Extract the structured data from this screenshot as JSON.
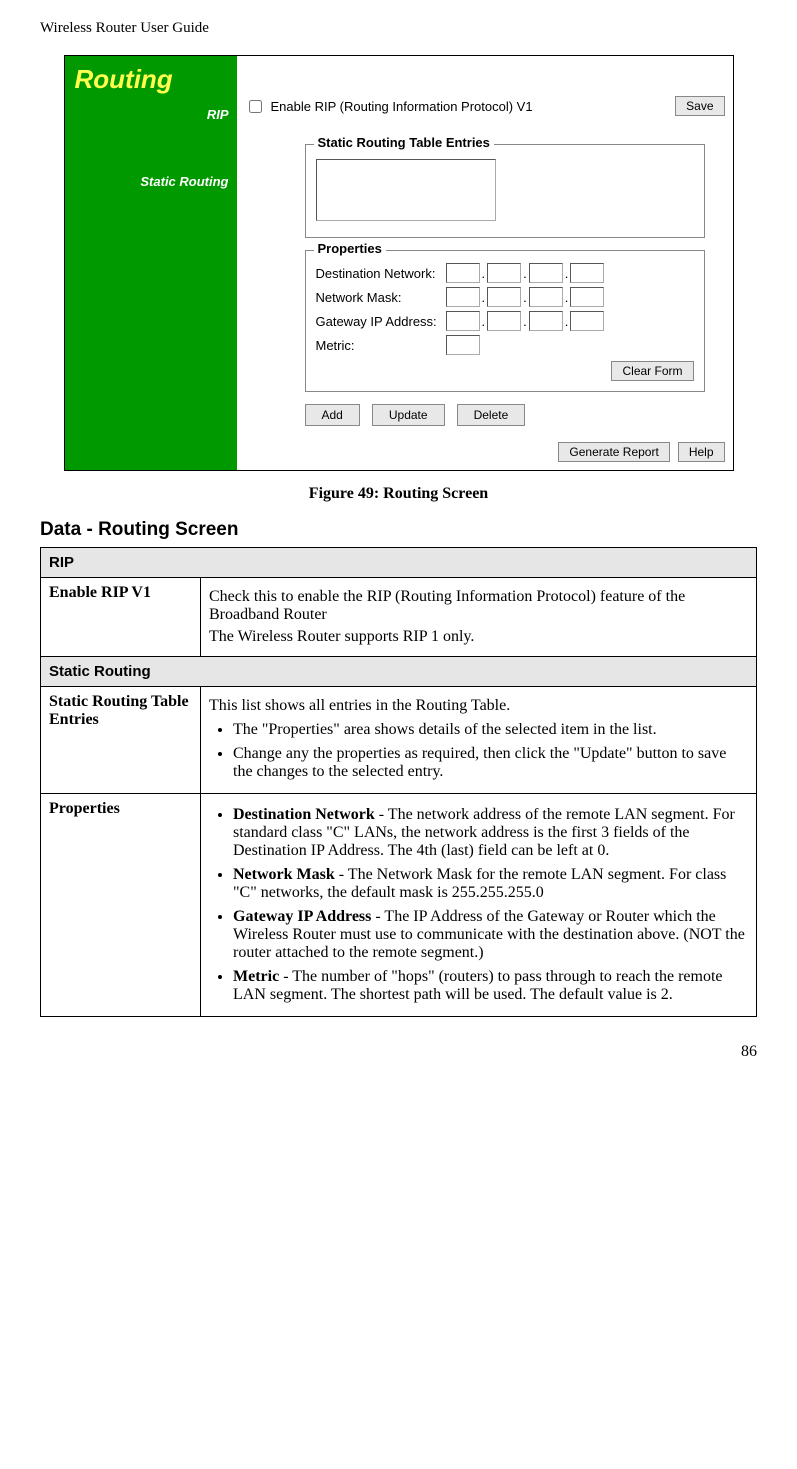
{
  "header": {
    "title": "Wireless Router User Guide"
  },
  "screenshot": {
    "panel_title": "Routing",
    "sidebar": {
      "rip": "RIP",
      "static": "Static Routing"
    },
    "rip": {
      "checkbox_label": "Enable RIP (Routing Information Protocol) V1",
      "save_btn": "Save"
    },
    "entries_fieldset": {
      "title": "Static Routing Table Entries"
    },
    "properties_fieldset": {
      "title": "Properties",
      "dest_net": "Destination Network:",
      "net_mask": "Network Mask:",
      "gw_ip": "Gateway IP Address:",
      "metric": "Metric:",
      "clear_btn": "Clear Form"
    },
    "btns": {
      "add": "Add",
      "update": "Update",
      "delete": "Delete"
    },
    "footer_btns": {
      "gen_report": "Generate Report",
      "help": "Help"
    }
  },
  "figure_caption": "Figure 49: Routing Screen",
  "section_heading": "Data - Routing Screen",
  "table": {
    "s1": "RIP",
    "r1_label": "Enable RIP V1",
    "r1_p1": "Check this to enable the RIP (Routing Information Protocol) feature of the Broadband Router",
    "r1_p2": "The Wireless Router supports RIP 1 only.",
    "s2": "Static Routing",
    "r2_label": "Static Routing Table Entries",
    "r2_p1": "This list shows all entries in the Routing Table.",
    "r2_b1": "The \"Properties\" area shows details of the selected item in the list.",
    "r2_b2": "Change any the properties as required, then click the \"Update\" button to save the changes to the selected entry.",
    "r3_label": "Properties",
    "r3_b1_strong": "Destination Network",
    "r3_b1_rest": " - The network address of the remote LAN segment. For standard class \"C\" LANs, the network address is the first 3 fields of the Destination IP Address. The 4th (last) field can be left at 0.",
    "r3_b2_strong": "Network Mask",
    "r3_b2_rest": " - The Network Mask for the remote LAN segment. For class \"C\" networks, the default mask is 255.255.255.0",
    "r3_b3_strong": "Gateway IP Address",
    "r3_b3_rest": " - The IP Address of the Gateway or Router which the Wireless Router must use to communicate with the destination above. (NOT the router attached to the remote segment.)",
    "r3_b4_strong": "Metric",
    "r3_b4_rest": " - The number of \"hops\" (routers) to pass through to reach the remote LAN segment. The shortest path will be used. The default value is 2."
  },
  "page_number": "86"
}
